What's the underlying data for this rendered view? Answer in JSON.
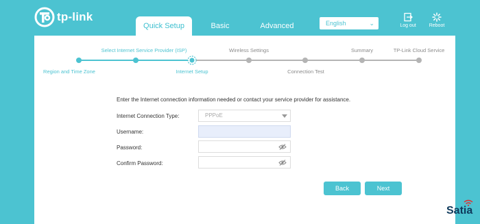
{
  "header": {
    "logo_text": "tp-link",
    "tabs": [
      {
        "label": "Quick Setup",
        "active": true
      },
      {
        "label": "Basic",
        "active": false
      },
      {
        "label": "Advanced",
        "active": false
      }
    ],
    "language": "English",
    "logout_label": "Log out",
    "reboot_label": "Reboot"
  },
  "steps": [
    {
      "label": "Region and Time Zone",
      "state": "done"
    },
    {
      "label": "Select Internet Service Provider (ISP)",
      "state": "done"
    },
    {
      "label": "Internet Setup",
      "state": "current"
    },
    {
      "label": "Wireless Settings",
      "state": "pending"
    },
    {
      "label": "Connection Test",
      "state": "pending"
    },
    {
      "label": "Summary",
      "state": "pending"
    },
    {
      "label": "TP-Link Cloud Service",
      "state": "pending"
    }
  ],
  "form": {
    "intro": "Enter the Internet connection information needed or contact your service provider for assistance.",
    "connection_type_label": "Internet Connection Type:",
    "connection_type_value": "PPPoE",
    "username_label": "Username:",
    "username_value": "",
    "password_label": "Password:",
    "password_value": "",
    "confirm_password_label": "Confirm Password:",
    "confirm_password_value": ""
  },
  "buttons": {
    "back": "Back",
    "next": "Next"
  },
  "watermark": "Satia",
  "colors": {
    "accent": "#4cc3d1",
    "pending": "#b4b4b4",
    "brand_dark": "#0f3a5c"
  }
}
